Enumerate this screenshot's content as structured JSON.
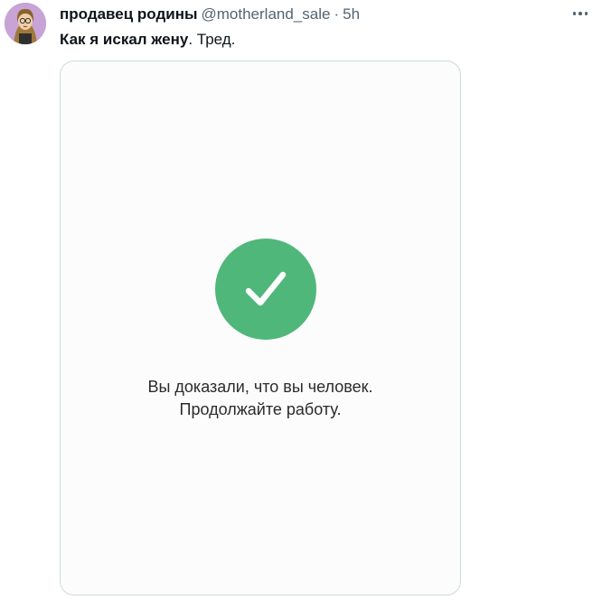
{
  "tweet": {
    "author_name": "продавец родины",
    "author_handle": "@motherland_sale",
    "separator": "·",
    "timestamp": "5h",
    "text_bold": "Как я искал жену",
    "text_rest": ". Тред."
  },
  "media": {
    "message_line1": "Вы доказали, что вы человек.",
    "message_line2": "Продолжайте работу.",
    "check_color": "#50b77b"
  },
  "icons": {
    "avatar": "cartoon-avatar",
    "more": "more-horizontal-icon",
    "check": "checkmark-icon"
  }
}
